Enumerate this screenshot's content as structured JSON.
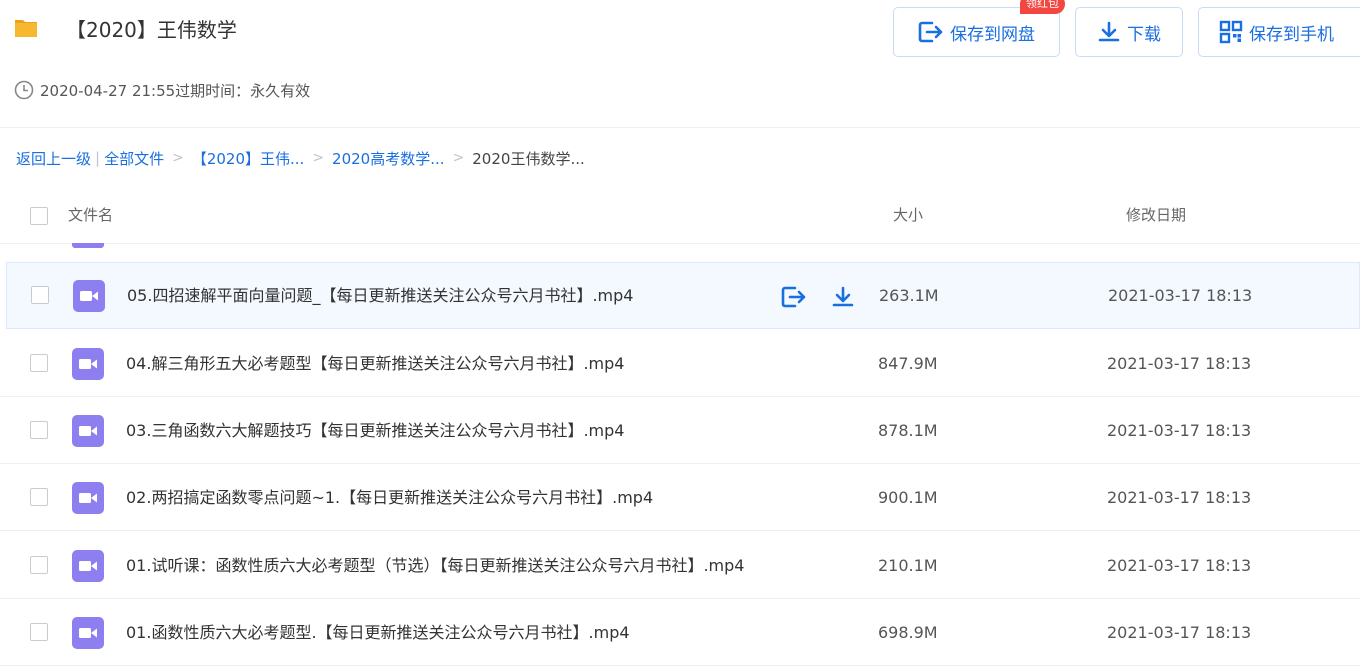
{
  "header": {
    "title": "【2020】王伟数学",
    "meta_text": "2020-04-27 21:55过期时间：永久有效",
    "buttons": {
      "save_label": "保存到网盘",
      "save_badge": "领红包",
      "download_label": "下载",
      "phone_label": "保存到手机"
    }
  },
  "breadcrumb": {
    "back": "返回上一级",
    "separator_bar": "|",
    "items": [
      "全部文件",
      "【2020】王伟...",
      "2020高考数学...",
      "2020王伟数学..."
    ],
    "separator": ">"
  },
  "table": {
    "columns": {
      "name": "文件名",
      "size": "大小",
      "date": "修改日期"
    },
    "rows": [
      {
        "name": "05.四招速解平面向量问题_【每日更新推送关注公众号六月书社】.mp4",
        "size": "263.1M",
        "date": "2021-03-17 18:13",
        "hovered": true
      },
      {
        "name": "04.解三角形五大必考题型【每日更新推送关注公众号六月书社】.mp4",
        "size": "847.9M",
        "date": "2021-03-17 18:13"
      },
      {
        "name": "03.三角函数六大解题技巧【每日更新推送关注公众号六月书社】.mp4",
        "size": "878.1M",
        "date": "2021-03-17 18:13"
      },
      {
        "name": "02.两招搞定函数零点问题~1.【每日更新推送关注公众号六月书社】.mp4",
        "size": "900.1M",
        "date": "2021-03-17 18:13"
      },
      {
        "name": "01.试听课：函数性质六大必考题型（节选）【每日更新推送关注公众号六月书社】.mp4",
        "size": "210.1M",
        "date": "2021-03-17 18:13"
      },
      {
        "name": "01.函数性质六大必考题型.【每日更新推送关注公众号六月书社】.mp4",
        "size": "698.9M",
        "date": "2021-03-17 18:13"
      }
    ]
  },
  "icons": {
    "folder": "folder-icon",
    "clock": "clock-icon",
    "save": "save-to-cloud-icon",
    "download": "download-icon",
    "phone": "qr-code-icon",
    "video": "video-file-icon"
  },
  "colors": {
    "accent": "#1a6fe0",
    "badge": "#f2463f",
    "video_icon": "#8d7ff0",
    "folder": "#f5b82e",
    "row_hover": "#f3f9ff"
  }
}
